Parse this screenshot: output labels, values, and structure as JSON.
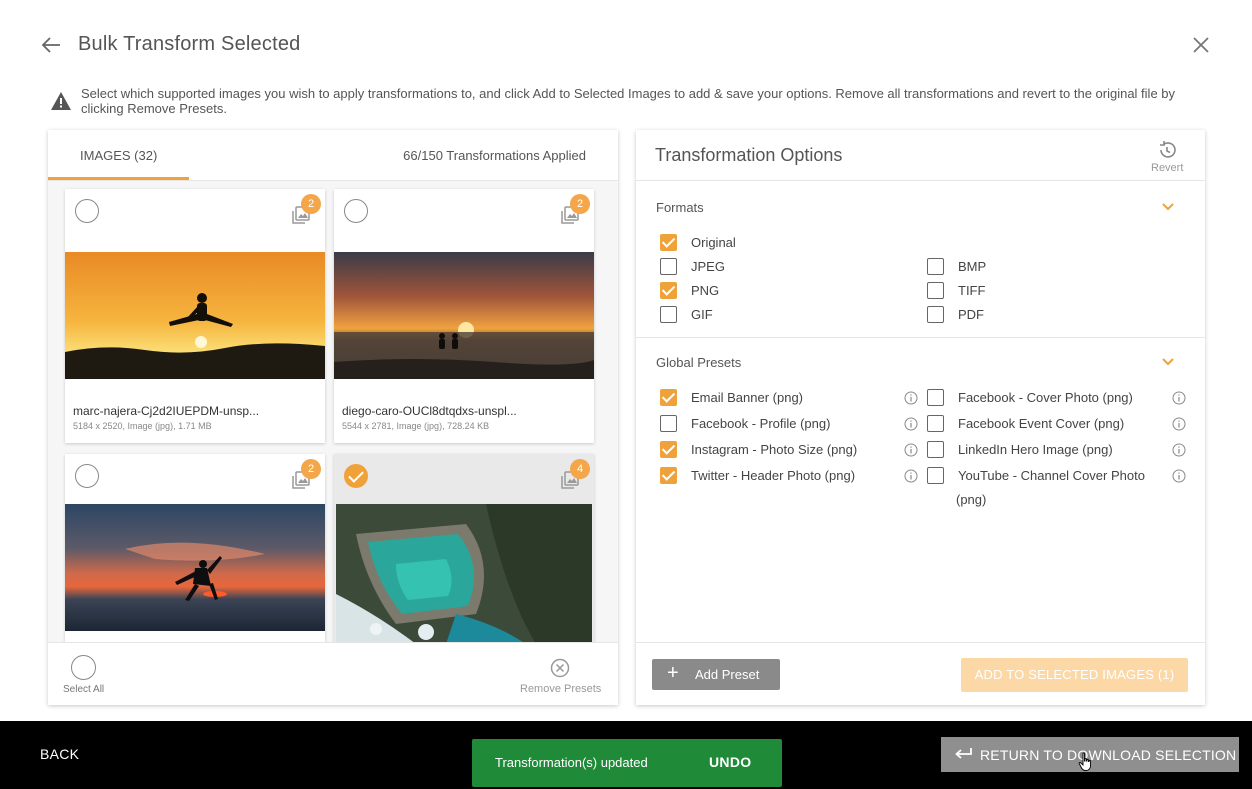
{
  "header": {
    "title": "Bulk Transform Selected"
  },
  "notice": {
    "text": "Select which supported images you wish to apply transformations to, and click Add to Selected Images to add & save your options. Remove all transformations and revert to the original file by clicking Remove Presets."
  },
  "left_panel": {
    "tab_images": "IMAGES (32)",
    "transformations_applied": "66/150 Transformations Applied",
    "cards": [
      {
        "selected": false,
        "badge": "2",
        "name": "marc-najera-Cj2d2IUEPDM-unsp...",
        "meta": "5184 x 2520, Image (jpg), 1.71 MB"
      },
      {
        "selected": false,
        "badge": "2",
        "name": "diego-caro-OUCl8dtqdxs-unspl...",
        "meta": "5544 x 2781, Image (jpg), 728.24 KB"
      },
      {
        "selected": false,
        "badge": "2",
        "name": "",
        "meta": ""
      },
      {
        "selected": true,
        "badge": "4",
        "name": "",
        "meta": ""
      }
    ],
    "select_all_label": "Select All",
    "remove_presets_label": "Remove Presets"
  },
  "right_panel": {
    "title": "Transformation Options",
    "revert_label": "Revert",
    "formats": {
      "title": "Formats",
      "options": [
        {
          "label": "Original",
          "checked": true
        },
        {
          "label": "JPEG",
          "checked": false
        },
        {
          "label": "PNG",
          "checked": true
        },
        {
          "label": "GIF",
          "checked": false
        },
        {
          "label": "BMP",
          "checked": false
        },
        {
          "label": "TIFF",
          "checked": false
        },
        {
          "label": "PDF",
          "checked": false
        }
      ]
    },
    "global_presets": {
      "title": "Global Presets",
      "options": [
        {
          "label": "Email Banner (png)",
          "checked": true
        },
        {
          "label": "Facebook - Profile (png)",
          "checked": false
        },
        {
          "label": "Instagram - Photo Size (png)",
          "checked": true
        },
        {
          "label": "Twitter - Header Photo (png)",
          "checked": true
        },
        {
          "label": "Facebook - Cover Photo (png)",
          "checked": false
        },
        {
          "label": "Facebook Event Cover (png)",
          "checked": false
        },
        {
          "label": "LinkedIn Hero Image (png)",
          "checked": false
        },
        {
          "label": "YouTube - Channel Cover Photo",
          "checked": false
        },
        {
          "label": "(png)",
          "checked": false
        }
      ]
    },
    "add_preset_label": "Add Preset",
    "add_selected_label": "ADD TO SELECTED IMAGES (1)"
  },
  "bottom_bar": {
    "back_label": "BACK",
    "toast_message": "Transformation(s) updated",
    "toast_undo": "UNDO",
    "return_label": "RETURN TO DOWNLOAD SELECTION"
  },
  "colors": {
    "accent": "#f0a23a",
    "toast": "#1f8a37",
    "bottom_bar": "#000000"
  }
}
